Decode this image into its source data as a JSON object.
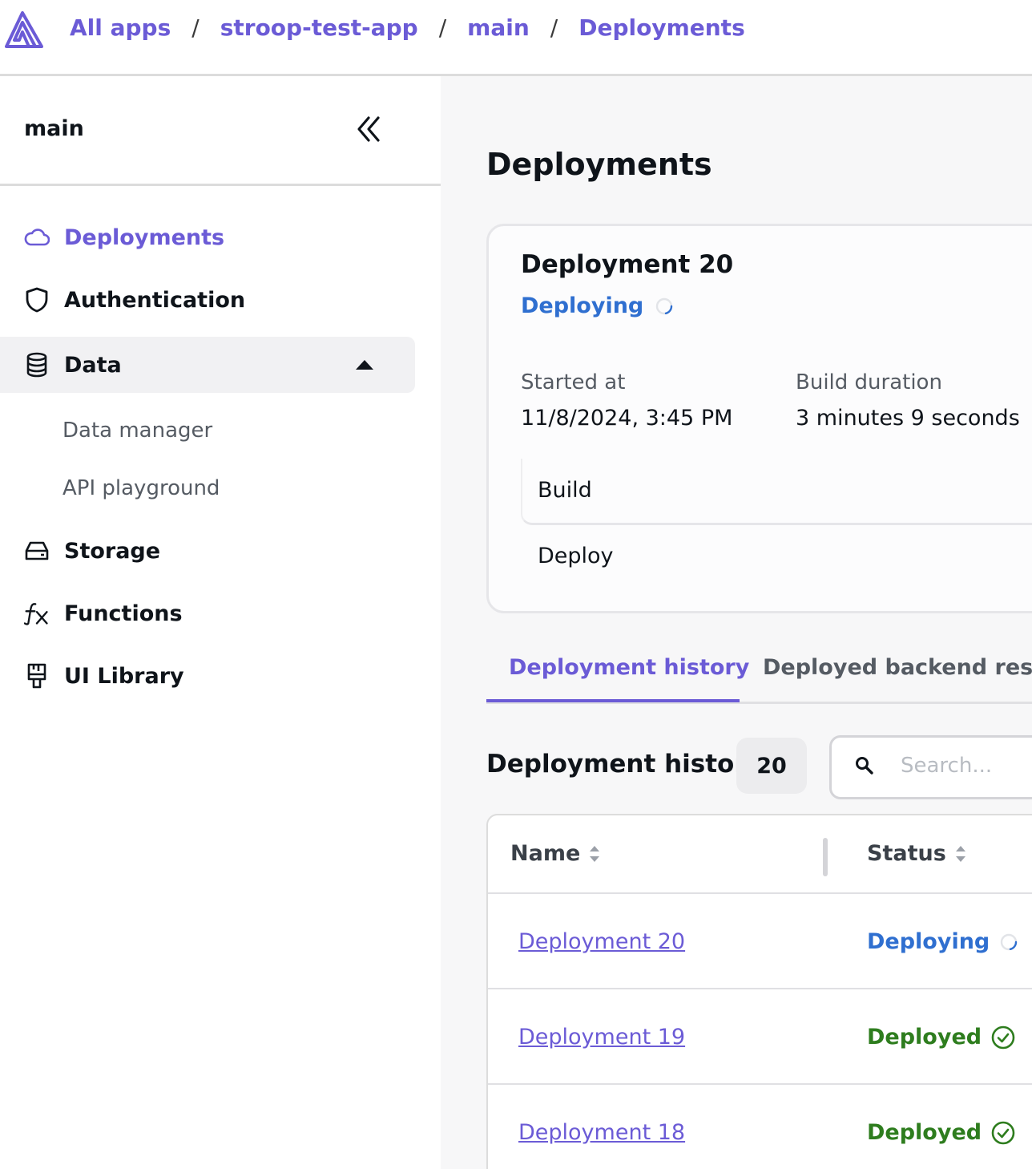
{
  "breadcrumb": {
    "items": [
      "All apps",
      "stroop-test-app",
      "main",
      "Deployments"
    ],
    "separator": "/"
  },
  "sidebar": {
    "title": "main",
    "items": [
      {
        "label": "Deployments",
        "icon": "cloud-icon",
        "active": true
      },
      {
        "label": "Authentication",
        "icon": "shield-icon"
      },
      {
        "label": "Data",
        "icon": "database-icon",
        "expanded": true
      },
      {
        "label": "Storage",
        "icon": "drive-icon"
      },
      {
        "label": "Functions",
        "icon": "function-icon"
      },
      {
        "label": "UI Library",
        "icon": "ui-library-icon"
      }
    ],
    "data_subitems": [
      "Data manager",
      "API playground"
    ]
  },
  "main": {
    "title": "Deployments",
    "card": {
      "title": "Deployment 20",
      "status": "Deploying",
      "started_label": "Started at",
      "started_value": "11/8/2024, 3:45 PM",
      "duration_label": "Build duration",
      "duration_value": "3 minutes 9 seconds",
      "steps": [
        "Build",
        "Deploy"
      ]
    },
    "tabs": [
      "Deployment history",
      "Deployed backend resources"
    ],
    "history": {
      "title": "Deployment history",
      "count": "20",
      "search_placeholder": "Search..."
    },
    "table": {
      "columns": [
        "Name",
        "Status"
      ],
      "rows": [
        {
          "name": "Deployment 20",
          "status": "Deploying"
        },
        {
          "name": "Deployment 19",
          "status": "Deployed"
        },
        {
          "name": "Deployment 18",
          "status": "Deployed"
        }
      ]
    }
  },
  "colors": {
    "accent": "#6b5bd6",
    "deploying": "#2f6fd0",
    "deployed": "#2e7d1e"
  }
}
